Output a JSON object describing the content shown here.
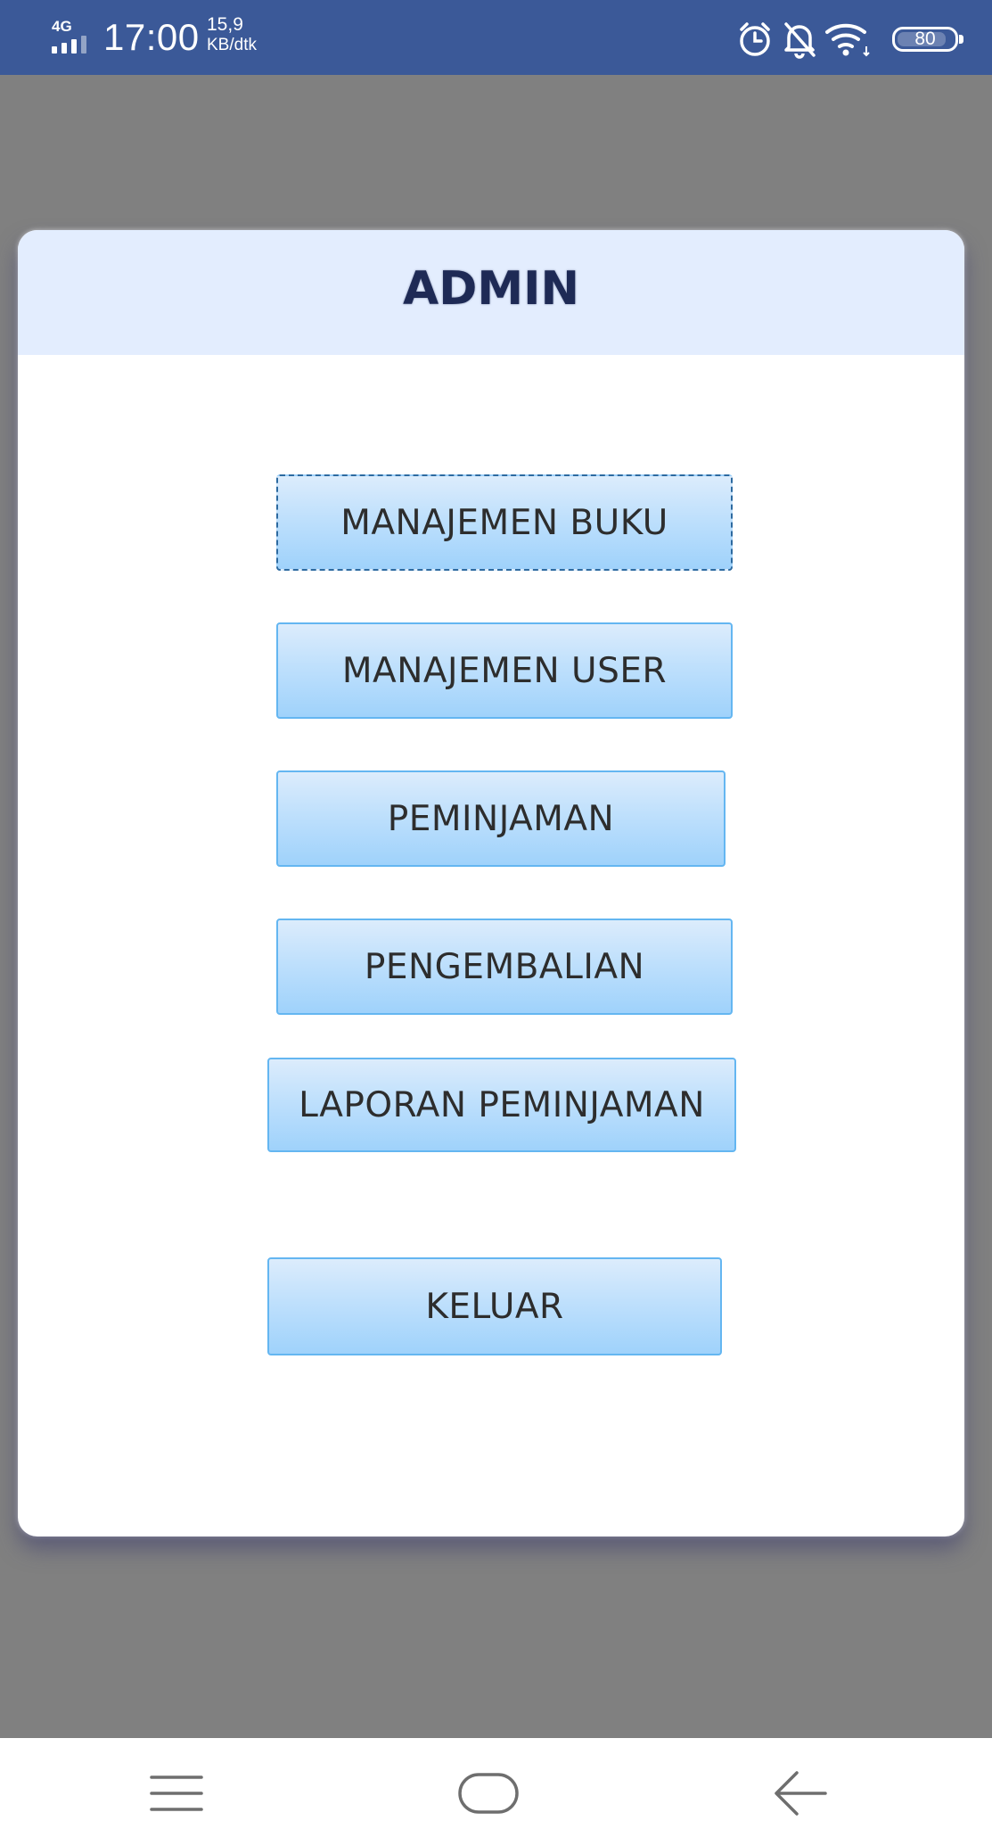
{
  "status_bar": {
    "network_type": "4G",
    "time": "17:00",
    "net_speed_value": "15,9",
    "net_speed_unit": "KB/dtk",
    "battery_level": "80",
    "icons": [
      "signal-icon",
      "alarm-icon",
      "bell-off-icon",
      "wifi-icon",
      "battery-icon"
    ]
  },
  "dialog": {
    "title": "ADMIN",
    "buttons": {
      "manajemen_buku": "MANAJEMEN BUKU",
      "manajemen_user": "MANAJEMEN USER",
      "peminjaman": "PEMINJAMAN",
      "pengembalian": "PENGEMBALIAN",
      "laporan_peminjaman": "LAPORAN PEMINJAMAN",
      "keluar": "KELUAR"
    },
    "focused_button": "MANAJEMEN BUKU"
  },
  "nav_bar": {
    "icons": [
      "menu-icon",
      "home-icon",
      "back-icon"
    ]
  },
  "colors": {
    "status_bar": "#3b5998",
    "backdrop": "#808080",
    "header_bg": "#e3edfe",
    "title_text": "#1e2a55",
    "button_border": "#64b6f1",
    "button_gradient_top": "#dcecfc",
    "button_gradient_bottom": "#9fd2fb"
  }
}
